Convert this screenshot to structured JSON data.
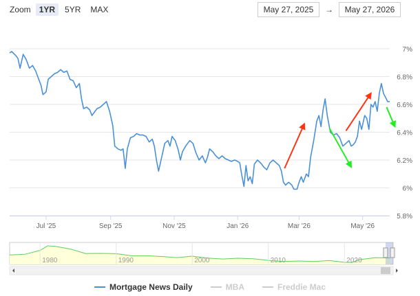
{
  "zoom": {
    "label": "Zoom",
    "options": [
      "1YR",
      "5YR",
      "MAX"
    ],
    "active": "1YR"
  },
  "range": {
    "from": "May 27, 2025",
    "arrow": "→",
    "to": "May 27, 2026"
  },
  "colors": {
    "main_series": "#4a90d9",
    "navigator_series": "#5fcf5f",
    "arrow_up": "#ff3311",
    "arrow_down": "#22ee22",
    "grid": "#e6e6e6",
    "hidden_legend": "#cccccc"
  },
  "legend": [
    {
      "name": "Mortgage News Daily",
      "visible": true
    },
    {
      "name": "MBA",
      "visible": false
    },
    {
      "name": "Freddie Mac",
      "visible": false
    }
  ],
  "chart_data": {
    "type": "line",
    "x_range": [
      "2025-05-27",
      "2026-05-27"
    ],
    "ylim": [
      5.8,
      7.0
    ],
    "y_ticks": [
      {
        "value": 5.8,
        "label": "5.8%"
      },
      {
        "value": 6.0,
        "label": "6%"
      },
      {
        "value": 6.2,
        "label": "6.2%"
      },
      {
        "value": 6.4,
        "label": "6.4%"
      },
      {
        "value": 6.6,
        "label": "6.6%"
      },
      {
        "value": 6.8,
        "label": "6.8%"
      },
      {
        "value": 7.0,
        "label": "7%"
      }
    ],
    "x_ticks": [
      {
        "date": "2025-07-01",
        "label": "Jul '25"
      },
      {
        "date": "2025-09-01",
        "label": "Sep '25"
      },
      {
        "date": "2025-11-01",
        "label": "Nov '25"
      },
      {
        "date": "2026-01-01",
        "label": "Jan '26"
      },
      {
        "date": "2026-03-01",
        "label": "Mar '26"
      },
      {
        "date": "2026-05-01",
        "label": "May '26"
      }
    ],
    "grid": true,
    "legend_position": "bottom-center",
    "series": [
      {
        "name": "Mortgage News Daily",
        "points": [
          [
            "2025-05-27",
            6.97
          ],
          [
            "2025-05-29",
            6.98
          ],
          [
            "2025-06-02",
            6.95
          ],
          [
            "2025-06-04",
            6.93
          ],
          [
            "2025-06-06",
            6.86
          ],
          [
            "2025-06-09",
            6.96
          ],
          [
            "2025-06-12",
            6.92
          ],
          [
            "2025-06-15",
            6.86
          ],
          [
            "2025-06-18",
            6.88
          ],
          [
            "2025-06-21",
            6.84
          ],
          [
            "2025-06-24",
            6.78
          ],
          [
            "2025-06-26",
            6.74
          ],
          [
            "2025-06-28",
            6.67
          ],
          [
            "2025-07-01",
            6.69
          ],
          [
            "2025-07-03",
            6.78
          ],
          [
            "2025-07-06",
            6.8
          ],
          [
            "2025-07-09",
            6.82
          ],
          [
            "2025-07-12",
            6.83
          ],
          [
            "2025-07-15",
            6.85
          ],
          [
            "2025-07-18",
            6.83
          ],
          [
            "2025-07-21",
            6.84
          ],
          [
            "2025-07-24",
            6.78
          ],
          [
            "2025-07-27",
            6.77
          ],
          [
            "2025-07-30",
            6.72
          ],
          [
            "2025-08-02",
            6.75
          ],
          [
            "2025-08-04",
            6.64
          ],
          [
            "2025-08-06",
            6.57
          ],
          [
            "2025-08-09",
            6.58
          ],
          [
            "2025-08-12",
            6.56
          ],
          [
            "2025-08-14",
            6.52
          ],
          [
            "2025-08-16",
            6.54
          ],
          [
            "2025-08-19",
            6.57
          ],
          [
            "2025-08-22",
            6.58
          ],
          [
            "2025-08-25",
            6.6
          ],
          [
            "2025-08-28",
            6.62
          ],
          [
            "2025-08-31",
            6.55
          ],
          [
            "2025-09-03",
            6.45
          ],
          [
            "2025-09-05",
            6.3
          ],
          [
            "2025-09-08",
            6.28
          ],
          [
            "2025-09-11",
            6.27
          ],
          [
            "2025-09-13",
            6.28
          ],
          [
            "2025-09-15",
            6.14
          ],
          [
            "2025-09-17",
            6.28
          ],
          [
            "2025-09-20",
            6.36
          ],
          [
            "2025-09-23",
            6.37
          ],
          [
            "2025-09-26",
            6.39
          ],
          [
            "2025-09-29",
            6.38
          ],
          [
            "2025-10-02",
            6.38
          ],
          [
            "2025-10-05",
            6.37
          ],
          [
            "2025-10-08",
            6.33
          ],
          [
            "2025-10-11",
            6.35
          ],
          [
            "2025-10-13",
            6.3
          ],
          [
            "2025-10-15",
            6.2
          ],
          [
            "2025-10-17",
            6.12
          ],
          [
            "2025-10-20",
            6.22
          ],
          [
            "2025-10-23",
            6.32
          ],
          [
            "2025-10-26",
            6.34
          ],
          [
            "2025-10-28",
            6.3
          ],
          [
            "2025-10-30",
            6.37
          ],
          [
            "2025-11-02",
            6.34
          ],
          [
            "2025-11-05",
            6.27
          ],
          [
            "2025-11-07",
            6.2
          ],
          [
            "2025-11-09",
            6.26
          ],
          [
            "2025-11-12",
            6.3
          ],
          [
            "2025-11-14",
            6.32
          ],
          [
            "2025-11-16",
            6.34
          ],
          [
            "2025-11-19",
            6.32
          ],
          [
            "2025-11-22",
            6.25
          ],
          [
            "2025-11-25",
            6.2
          ],
          [
            "2025-11-28",
            6.23
          ],
          [
            "2025-12-01",
            6.18
          ],
          [
            "2025-12-03",
            6.22
          ],
          [
            "2025-12-05",
            6.28
          ],
          [
            "2025-12-08",
            6.26
          ],
          [
            "2025-12-11",
            6.23
          ],
          [
            "2025-12-14",
            6.21
          ],
          [
            "2025-12-17",
            6.23
          ],
          [
            "2025-12-20",
            6.21
          ],
          [
            "2025-12-23",
            6.2
          ],
          [
            "2025-12-26",
            6.19
          ],
          [
            "2025-12-29",
            6.2
          ],
          [
            "2026-01-01",
            6.19
          ],
          [
            "2026-01-03",
            6.18
          ],
          [
            "2026-01-05",
            6.09
          ],
          [
            "2026-01-07",
            6.01
          ],
          [
            "2026-01-09",
            6.16
          ],
          [
            "2026-01-11",
            6.05
          ],
          [
            "2026-01-13",
            6.08
          ],
          [
            "2026-01-15",
            6.03
          ],
          [
            "2026-01-17",
            6.17
          ],
          [
            "2026-01-20",
            6.2
          ],
          [
            "2026-01-23",
            6.18
          ],
          [
            "2026-01-26",
            6.15
          ],
          [
            "2026-01-29",
            6.13
          ],
          [
            "2026-02-01",
            6.18
          ],
          [
            "2026-02-04",
            6.2
          ],
          [
            "2026-02-07",
            6.18
          ],
          [
            "2026-02-10",
            6.16
          ],
          [
            "2026-02-12",
            6.12
          ],
          [
            "2026-02-14",
            6.04
          ],
          [
            "2026-02-16",
            6.02
          ],
          [
            "2026-02-19",
            6.04
          ],
          [
            "2026-02-22",
            6.02
          ],
          [
            "2026-02-24",
            5.99
          ],
          [
            "2026-02-27",
            5.99
          ],
          [
            "2026-03-01",
            6.04
          ],
          [
            "2026-03-03",
            6.08
          ],
          [
            "2026-03-05",
            6.04
          ],
          [
            "2026-03-08",
            6.1
          ],
          [
            "2026-03-10",
            6.08
          ],
          [
            "2026-03-12",
            6.22
          ],
          [
            "2026-03-15",
            6.34
          ],
          [
            "2026-03-18",
            6.48
          ],
          [
            "2026-03-20",
            6.52
          ],
          [
            "2026-03-22",
            6.44
          ],
          [
            "2026-03-24",
            6.56
          ],
          [
            "2026-03-26",
            6.64
          ],
          [
            "2026-03-28",
            6.52
          ],
          [
            "2026-03-31",
            6.4
          ],
          [
            "2026-04-03",
            6.38
          ],
          [
            "2026-04-06",
            6.39
          ],
          [
            "2026-04-09",
            6.36
          ],
          [
            "2026-04-12",
            6.3
          ],
          [
            "2026-04-15",
            6.32
          ],
          [
            "2026-04-18",
            6.34
          ],
          [
            "2026-04-20",
            6.3
          ],
          [
            "2026-04-22",
            6.31
          ],
          [
            "2026-04-24",
            6.33
          ],
          [
            "2026-04-26",
            6.37
          ],
          [
            "2026-04-28",
            6.48
          ],
          [
            "2026-04-30",
            6.42
          ],
          [
            "2026-05-03",
            6.52
          ],
          [
            "2026-05-05",
            6.5
          ],
          [
            "2026-05-07",
            6.42
          ],
          [
            "2026-05-09",
            6.6
          ],
          [
            "2026-05-11",
            6.58
          ],
          [
            "2026-05-13",
            6.62
          ],
          [
            "2026-05-15",
            6.55
          ],
          [
            "2026-05-17",
            6.68
          ],
          [
            "2026-05-19",
            6.75
          ],
          [
            "2026-05-21",
            6.68
          ],
          [
            "2026-05-23",
            6.65
          ],
          [
            "2026-05-25",
            6.62
          ],
          [
            "2026-05-27",
            6.62
          ]
        ]
      }
    ],
    "annotations": [
      {
        "type": "arrow",
        "direction": "up",
        "from": [
          "2026-02-15",
          6.14
        ],
        "to": [
          "2026-03-06",
          6.46
        ]
      },
      {
        "type": "arrow",
        "direction": "down",
        "from": [
          "2026-03-30",
          6.43
        ],
        "to": [
          "2026-04-20",
          6.15
        ]
      },
      {
        "type": "arrow",
        "direction": "up",
        "from": [
          "2026-04-15",
          6.41
        ],
        "to": [
          "2026-05-09",
          6.68
        ]
      },
      {
        "type": "arrow",
        "direction": "down",
        "from": [
          "2026-05-24",
          6.58
        ],
        "to": [
          "2026-06-01",
          6.44
        ]
      }
    ],
    "navigator": {
      "x_ticks": [
        "1980",
        "1990",
        "2000",
        "2010",
        "2020"
      ],
      "years": [
        1976,
        1978,
        1980,
        1981,
        1982,
        1984,
        1986,
        1988,
        1990,
        1992,
        1994,
        1996,
        1998,
        2000,
        2002,
        2004,
        2006,
        2008,
        2010,
        2012,
        2014,
        2016,
        2018,
        2020,
        2021,
        2022,
        2024,
        2026
      ],
      "values": [
        9.0,
        9.6,
        12.8,
        16.5,
        16.0,
        13.9,
        10.2,
        10.3,
        10.1,
        8.4,
        8.4,
        7.8,
        6.9,
        8.1,
        6.5,
        5.8,
        6.4,
        6.0,
        4.7,
        3.7,
        4.2,
        3.7,
        4.5,
        3.1,
        3.0,
        5.3,
        6.8,
        6.6
      ]
    }
  }
}
